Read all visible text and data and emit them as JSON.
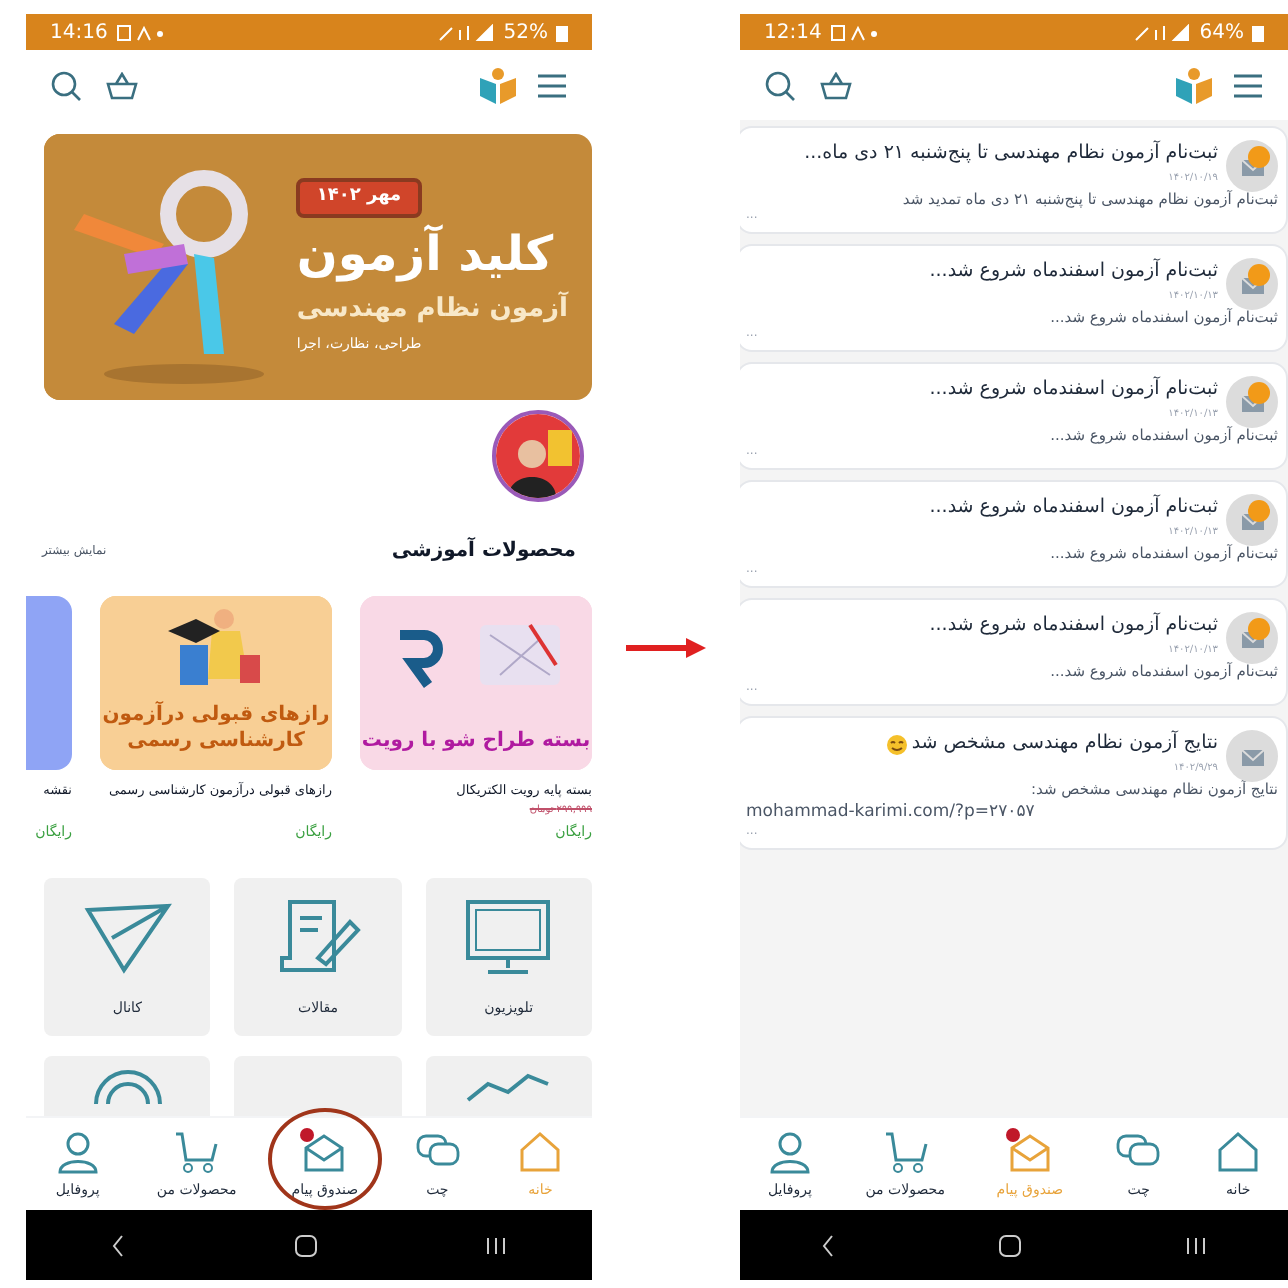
{
  "left_screen": {
    "status_bar": {
      "time": "14:16",
      "battery": "52%"
    },
    "banner": {
      "badge": "مهر ۱۴۰۲",
      "title": "کلید آزمون",
      "subtitle": "آزمون نظام مهندسی",
      "tagline": "طراحی، نظارت، اجرا"
    },
    "section": {
      "title": "محصولات آموزشی",
      "more": "نمایش بیشتر"
    },
    "products": [
      {
        "art_text": "بسته طراح شو با رویت",
        "title": "بسته پایه رویت الکتریکال",
        "old_price": "۲۹۹,۹۹۹ تومان",
        "price": "رایگان",
        "color": "#f9d9e6"
      },
      {
        "art_text": "رازهای قبولی درآزمون کارشناسی رسمی",
        "title": "رازهای قبولی درآزمون کارشناسی رسمی",
        "price": "رایگان",
        "color": "#f8cf95"
      },
      {
        "title": "نقشه",
        "price": "رایگان",
        "color": "#8fa4f5"
      }
    ],
    "tiles": [
      {
        "kind": "tv",
        "label": "تلویزیون"
      },
      {
        "kind": "article",
        "label": "مقالات"
      },
      {
        "kind": "channel",
        "label": "کانال"
      },
      {
        "kind": "chart"
      },
      {
        "kind": "blank"
      },
      {
        "kind": "signal"
      }
    ],
    "nav": [
      {
        "kind": "home",
        "label": "خانه",
        "selected": true,
        "badge": false,
        "circled": false
      },
      {
        "kind": "chat",
        "label": "چت",
        "selected": false,
        "badge": false,
        "circled": false
      },
      {
        "kind": "inbox",
        "label": "صندوق پیام",
        "selected": false,
        "badge": true,
        "circled": true
      },
      {
        "kind": "cart",
        "label": "محصولات من",
        "selected": false,
        "badge": false,
        "circled": false
      },
      {
        "kind": "profile",
        "label": "پروفایل",
        "selected": false,
        "badge": false,
        "circled": false
      }
    ]
  },
  "right_screen": {
    "status_bar": {
      "time": "12:14",
      "battery": "64%"
    },
    "messages": [
      {
        "title": "ثبت‌نام آزمون نظام مهندسی تا پنج‌شنبه ۲۱ دی ماه...",
        "date": "۱۴۰۲/۱۰/۱۹",
        "body": "ثبت‌نام آزمون نظام مهندسی تا پنج‌شنبه ۲۱ دی ماه تمدید شد",
        "more": "...",
        "unread": true,
        "emoji": false
      },
      {
        "title": "ثبت‌نام آزمون اسفندماه شروع شد...",
        "date": "۱۴۰۲/۱۰/۱۳",
        "body": "ثبت‌نام آزمون اسفندماه شروع شد...",
        "more": "...",
        "unread": true,
        "emoji": false
      },
      {
        "title": "ثبت‌نام آزمون اسفندماه شروع شد...",
        "date": "۱۴۰۲/۱۰/۱۳",
        "body": "ثبت‌نام آزمون اسفندماه شروع شد...",
        "more": "...",
        "unread": true,
        "emoji": false
      },
      {
        "title": "ثبت‌نام آزمون اسفندماه شروع شد...",
        "date": "۱۴۰۲/۱۰/۱۳",
        "body": "ثبت‌نام آزمون اسفندماه شروع شد...",
        "more": "...",
        "unread": true,
        "emoji": false
      },
      {
        "title": "ثبت‌نام آزمون اسفندماه شروع شد...",
        "date": "۱۴۰۲/۱۰/۱۳",
        "body": "ثبت‌نام آزمون اسفندماه شروع شد...",
        "more": "...",
        "unread": true,
        "emoji": false
      },
      {
        "title": "نتایج آزمون نظام مهندسی مشخص شد",
        "date": "۱۴۰۲/۹/۲۹",
        "body": "نتایج آزمون نظام مهندسی مشخص شد:",
        "link": "mohammad-karimi.com/?p=۲۷۰۵۷",
        "more": "...",
        "unread": false,
        "emoji": true
      }
    ],
    "nav": [
      {
        "kind": "home",
        "label": "خانه",
        "selected": false,
        "badge": false,
        "circled": false
      },
      {
        "kind": "chat",
        "label": "چت",
        "selected": false,
        "badge": false,
        "circled": false
      },
      {
        "kind": "inbox",
        "label": "صندوق پیام",
        "selected": true,
        "badge": true,
        "circled": false
      },
      {
        "kind": "cart",
        "label": "محصولات من",
        "selected": false,
        "badge": false,
        "circled": false
      },
      {
        "kind": "profile",
        "label": "پروفایل",
        "selected": false,
        "badge": false,
        "circled": false
      }
    ]
  }
}
